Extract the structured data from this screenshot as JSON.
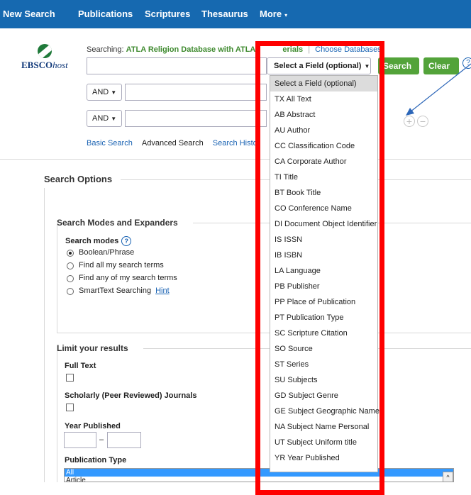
{
  "nav": {
    "items": [
      "New Search",
      "Publications",
      "Scriptures",
      "Thesaurus",
      "More"
    ],
    "more_caret": "▾"
  },
  "logo": {
    "brand_bold": "EBSCO",
    "brand_italic": "host"
  },
  "search": {
    "searching_label": "Searching:",
    "database": "ATLA Religion Database with ATLA",
    "database_tail": "erials",
    "choose_databases": "Choose Databases",
    "field_select": "Select a Field (optional)",
    "search_button": "Search",
    "clear_button": "Clear",
    "help_icon": "?",
    "bool_row2": "AND",
    "bool_row3": "AND",
    "plus_icon": "+",
    "minus_icon": "−"
  },
  "links": {
    "basic": "Basic Search",
    "advanced": "Advanced Search",
    "history": "Search Histo"
  },
  "options": {
    "title": "Search Options",
    "modes_title": "Search Modes and Expanders",
    "modes_label": "Search modes",
    "modes_help": "?",
    "modes": [
      "Boolean/Phrase",
      "Find all my search terms",
      "Find any of my search terms",
      "SmartText Searching"
    ],
    "hint": "Hint",
    "selected_mode": 0
  },
  "limit": {
    "title": "Limit your results",
    "full_text": "Full Text",
    "scholarly": "Scholarly (Peer Reviewed) Journals",
    "year_published": "Year Published",
    "year_dash": "–",
    "publication_type": "Publication Type",
    "pub_types": [
      "All",
      "Article"
    ]
  },
  "dropdown": {
    "items": [
      "Select a Field (optional)",
      "TX All Text",
      "AB Abstract",
      "AU Author",
      "CC Classification Code",
      "CA Corporate Author",
      "TI Title",
      "BT Book Title",
      "CO Conference Name",
      "DI Document Object Identifier",
      "IS ISSN",
      "IB ISBN",
      "LA Language",
      "PB Publisher",
      "PP Place of Publication",
      "PT Publication Type",
      "SC Scripture Citation",
      "SO Source",
      "ST Series",
      "SU Subjects",
      "GD Subject Genre",
      "GE Subject Geographic Name",
      "NA Subject Name Personal",
      "UT Subject Uniform title",
      "YR Year Published"
    ],
    "highlighted_index": 0
  },
  "colors": {
    "nav_bg": "#1669b0",
    "accent_green": "#53a33a",
    "link_blue": "#1a63b3",
    "annotation_red": "#ff0000"
  }
}
